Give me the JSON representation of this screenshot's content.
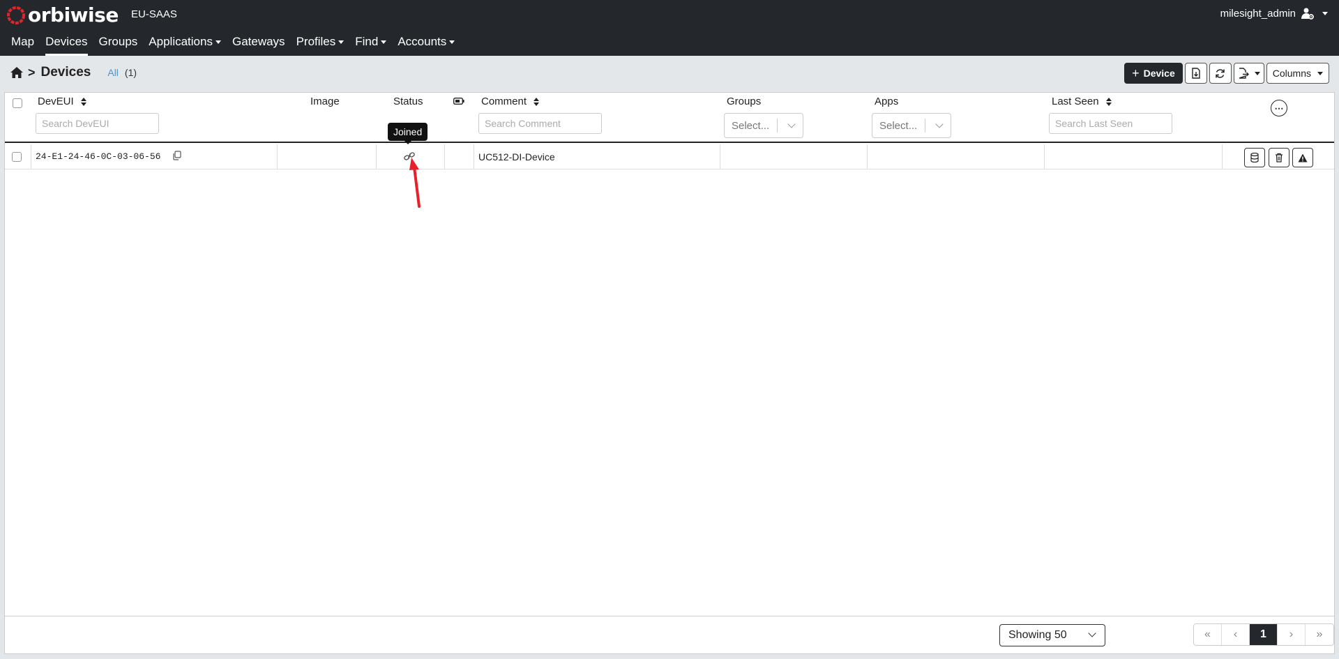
{
  "app": {
    "brand": "orbiwise",
    "tenant": "EU-SAAS",
    "username": "milesight_admin"
  },
  "nav": [
    {
      "label": "Map",
      "dropdown": false
    },
    {
      "label": "Devices",
      "dropdown": false,
      "active": true
    },
    {
      "label": "Groups",
      "dropdown": false
    },
    {
      "label": "Applications",
      "dropdown": true
    },
    {
      "label": "Gateways",
      "dropdown": false
    },
    {
      "label": "Profiles",
      "dropdown": true
    },
    {
      "label": "Find",
      "dropdown": true
    },
    {
      "label": "Accounts",
      "dropdown": true
    }
  ],
  "header": {
    "separator": ">",
    "title": "Devices",
    "filter_label": "All",
    "filter_count": "(1)"
  },
  "toolbar": {
    "add_device_label": "Device",
    "columns_label": "Columns"
  },
  "columns": {
    "deveui": "DevEUI",
    "image": "Image",
    "status": "Status",
    "comment": "Comment",
    "groups": "Groups",
    "apps": "Apps",
    "last_seen": "Last Seen"
  },
  "filters": {
    "deveui_placeholder": "Search DevEUI",
    "comment_placeholder": "Search Comment",
    "last_seen_placeholder": "Search Last Seen",
    "groups_select": "Select...",
    "apps_select": "Select..."
  },
  "rows": [
    {
      "deveui": "24-E1-24-46-0C-03-06-56",
      "status": "Joined",
      "comment": "UC512-DI-Device",
      "groups": "",
      "apps": "",
      "last_seen": ""
    }
  ],
  "tooltip": "Joined",
  "footer": {
    "page_size": "Showing 50",
    "current_page": "1"
  },
  "colors": {
    "topbar": "#24282c",
    "accent": "#3b9bd6",
    "logo_red": "#e0262d",
    "arrow": "#e8202a"
  }
}
